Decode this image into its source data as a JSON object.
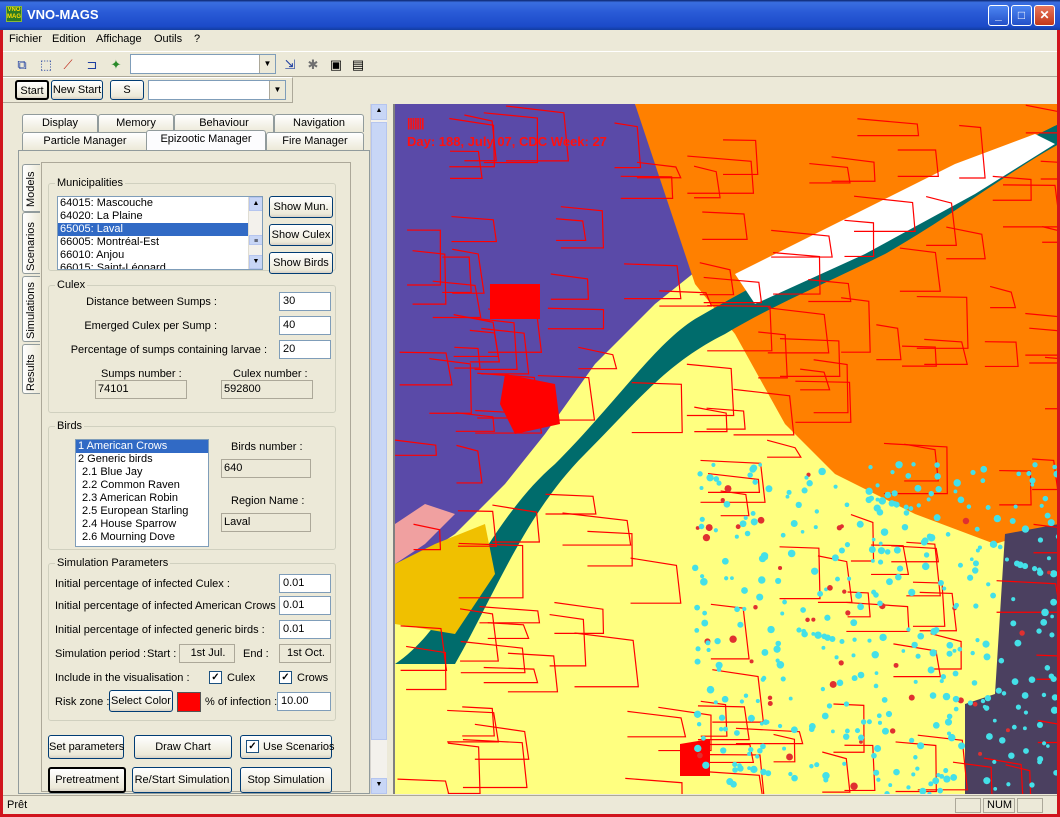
{
  "window": {
    "title": "VNO-MAGS",
    "icon_text": "VNO MAGS",
    "minimize": "_",
    "maximize": "□",
    "close": "✕"
  },
  "menu": [
    "Fichier",
    "Edition",
    "Affichage",
    "Outils",
    "?"
  ],
  "toolbar2": {
    "start": "Start",
    "new_start": "New Start",
    "s": "S"
  },
  "tabs_row1": [
    "Display",
    "Memory",
    "Behaviour",
    "Navigation"
  ],
  "tabs_row2": [
    "Particle Manager",
    "Epizootic Manager",
    "Fire Manager"
  ],
  "vtabs": [
    "Models",
    "Scenarios",
    "Simulations",
    "Results"
  ],
  "municipalities": {
    "title": "Municipalities",
    "items": [
      "64015: Mascouche",
      "64020: La Plaine",
      "65005: Laval",
      "66005: Montréal-Est",
      "66010: Anjou",
      "66015: Saint-Léonard"
    ],
    "selected": 2,
    "buttons": [
      "Show Mun.",
      "Show Culex",
      "Show Birds"
    ]
  },
  "culex": {
    "title": "Culex",
    "distance_label": "Distance between Sumps :",
    "distance": "30",
    "emerged_label": "Emerged Culex per Sump :",
    "emerged": "40",
    "pct_label": "Percentage of sumps containing larvae :",
    "pct": "20",
    "sumps_label": "Sumps number :",
    "sumps": "74101",
    "culex_label": "Culex number :",
    "culex_num": "592800"
  },
  "birds": {
    "title": "Birds",
    "items": [
      "1 American Crows",
      "2 Generic birds",
      "2.1 Blue Jay",
      "2.2 Common Raven",
      "2.3 American Robin",
      "2.5 European Starling",
      "2.4 House Sparrow",
      "2.6 Mourning Dove"
    ],
    "selected": 0,
    "number_label": "Birds number :",
    "number": "640",
    "region_label": "Region Name :",
    "region": "Laval"
  },
  "sim": {
    "title": "Simulation Parameters",
    "inf_culex_label": "Initial percentage of infected Culex :",
    "inf_culex": "0.01",
    "inf_crows_label": "Initial percentage of infected American Crows :",
    "inf_crows": "0.01",
    "inf_generic_label": "Initial percentage of infected generic birds :",
    "inf_generic": "0.01",
    "period_label": "Simulation period :",
    "start_label": "Start :",
    "start": "1st Jul.",
    "end_label": "End :",
    "end": "1st Oct.",
    "include_label": "Include in the visualisation :",
    "culex_chk": "Culex",
    "crows_chk": "Crows",
    "risk_label": "Risk zone :",
    "select_color": "Select Color",
    "infection_label": "% of infection :",
    "infection": "10.00",
    "risk_color": "#ff0000"
  },
  "bottom_buttons": {
    "set_params": "Set parameters",
    "draw_chart": "Draw Chart",
    "use_scenarios": "Use Scenarios",
    "pretreatment": "Pretreatment",
    "restart": "Re/Start Simulation",
    "stop": "Stop Simulation"
  },
  "map": {
    "ticks": "|||||||",
    "day_text": "Day: 188, July 07, CDC Week: 27",
    "colors": {
      "purple": "#5a4aa8",
      "orange": "#ff8000",
      "yellow": "#ffff80",
      "water": "#006c6c",
      "border": "#ff0000",
      "dark": "#4b4060",
      "points": "#44e0e8"
    }
  },
  "status": {
    "text": "Prêt",
    "num": "NUM"
  }
}
